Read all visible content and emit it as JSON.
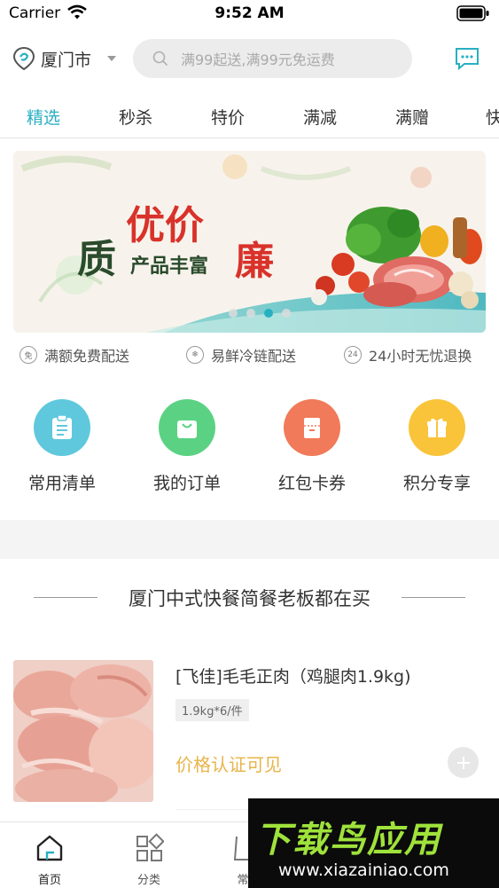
{
  "status_bar": {
    "carrier": "Carrier",
    "time": "9:52 AM"
  },
  "header": {
    "city": "厦门市",
    "search_placeholder": "满99起送,满99元免运费"
  },
  "tabs": [
    "精选",
    "秒杀",
    "特价",
    "满减",
    "满赠",
    "快"
  ],
  "active_tab": "精选",
  "banner": {
    "line1": "优价",
    "line2a": "质",
    "line2b": "廉",
    "subtitle": "产品丰富"
  },
  "features": [
    {
      "icon_text": "免",
      "label": "满额免费配送"
    },
    {
      "icon_text": "❄",
      "label": "易鲜冷链配送"
    },
    {
      "icon_text": "24",
      "label": "24小时无忧退换"
    }
  ],
  "quick_entries": [
    {
      "label": "常用清单",
      "icon": "clipboard-icon",
      "color": "#5fc8dc"
    },
    {
      "label": "我的订单",
      "icon": "bag-icon",
      "color": "#5bd283"
    },
    {
      "label": "红包卡券",
      "icon": "coupon-icon",
      "color": "#f07a5a"
    },
    {
      "label": "积分专享",
      "icon": "gift-icon",
      "color": "#f9c43a"
    }
  ],
  "section": {
    "title": "厦门中式快餐简餐老板都在买"
  },
  "product": {
    "name": "[飞佳]毛毛正肉（鸡腿肉1.9kg)",
    "spec": "1.9kg*6/件",
    "price_text": "价格认证可见"
  },
  "bottom_nav": [
    {
      "label": "首页",
      "icon": "home-icon"
    },
    {
      "label": "分类",
      "icon": "category-icon"
    },
    {
      "label": "常",
      "icon": "list-icon"
    }
  ],
  "watermark": {
    "title": "下载鸟应用",
    "url": "www.xiazainiao.com"
  },
  "colors": {
    "accent": "#28b0c2",
    "price": "#e8b44a"
  }
}
